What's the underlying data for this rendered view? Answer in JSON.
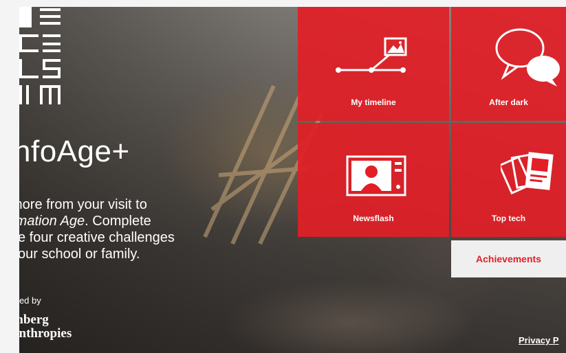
{
  "intro": {
    "title": "nfoAge+",
    "desc_line1": "more from your visit to",
    "desc_line2": "rmation Age",
    "desc_line2_suffix": ". Complete",
    "desc_line3": "se four creative challenges",
    "desc_line4": "your school or family."
  },
  "sponsor": {
    "supported_by": "rted by",
    "name_line1": "mberg",
    "name_line2": "anthropies"
  },
  "tiles": [
    {
      "label": "My timeline",
      "icon": "timeline-icon"
    },
    {
      "label": "After dark",
      "icon": "speech-bubbles-icon"
    },
    {
      "label": "Newsflash",
      "icon": "tv-icon"
    },
    {
      "label": "Top tech",
      "icon": "cards-icon"
    }
  ],
  "achievements_label": "Achievements",
  "privacy_label": "Privacy P",
  "colors": {
    "brand_red": "#e21e26",
    "tile_text": "#ffffff",
    "achievements_bg": "#efefef"
  }
}
